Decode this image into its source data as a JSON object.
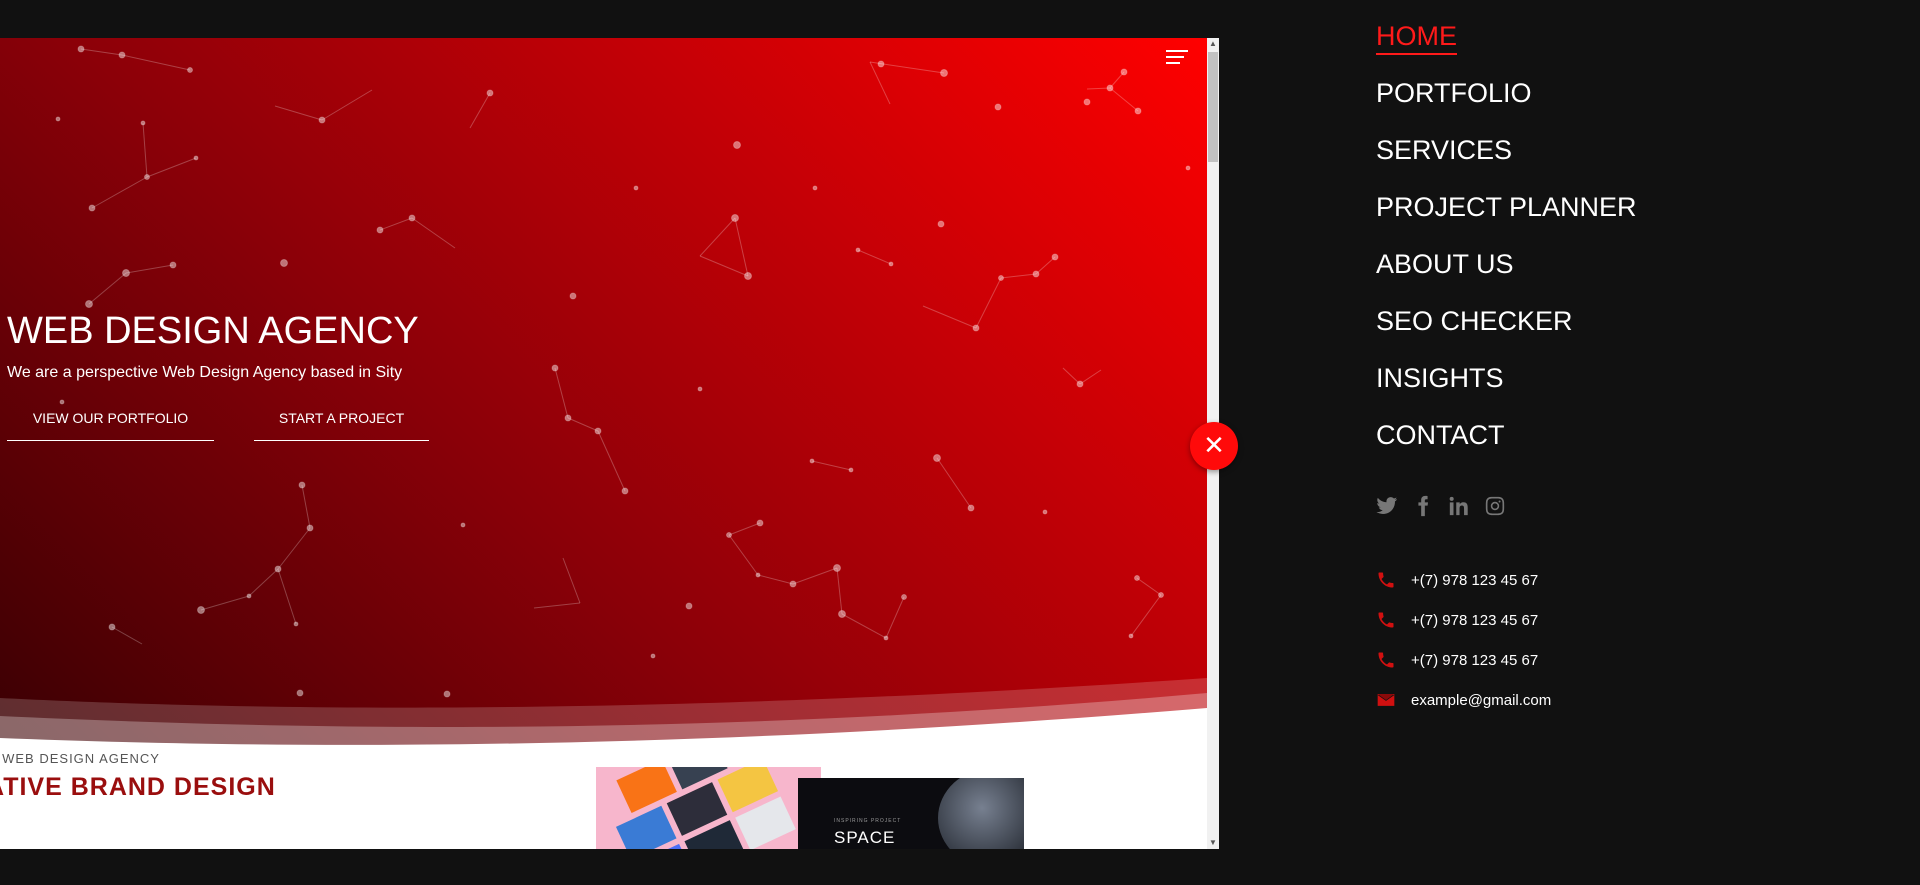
{
  "hero": {
    "title": "WEB DESIGN AGENCY",
    "subtitle": "We are a perspective Web Design Agency based in Sity",
    "btn_portfolio": "VIEW OUR PORTFOLIO",
    "btn_project": "START A PROJECT"
  },
  "section": {
    "eyebrow": "NG WEB DESIGN AGENCY",
    "title": "ATIVE BRAND DESIGN"
  },
  "thumb": {
    "space_small": "INSPIRING PROJECT",
    "space_title": "SPACE"
  },
  "menu": {
    "items": [
      {
        "label": "HOME"
      },
      {
        "label": "PORTFOLIO"
      },
      {
        "label": "SERVICES"
      },
      {
        "label": "PROJECT PLANNER"
      },
      {
        "label": "ABOUT US"
      },
      {
        "label": "SEO CHECKER"
      },
      {
        "label": "INSIGHTS"
      },
      {
        "label": "CONTACT"
      }
    ],
    "active": "HOME"
  },
  "socials": [
    "twitter-icon",
    "facebook-icon",
    "linkedin-icon",
    "instagram-icon"
  ],
  "contacts": {
    "phone1": "+(7) 978 123 45 67",
    "phone2": "+(7) 978 123 45 67",
    "phone3": "+(7) 978 123 45 67",
    "email": "example@gmail.com"
  },
  "colors": {
    "accent": "#ff1a1a",
    "background": "#111111",
    "hero_start": "#ff0000",
    "hero_end": "#3a0003"
  }
}
